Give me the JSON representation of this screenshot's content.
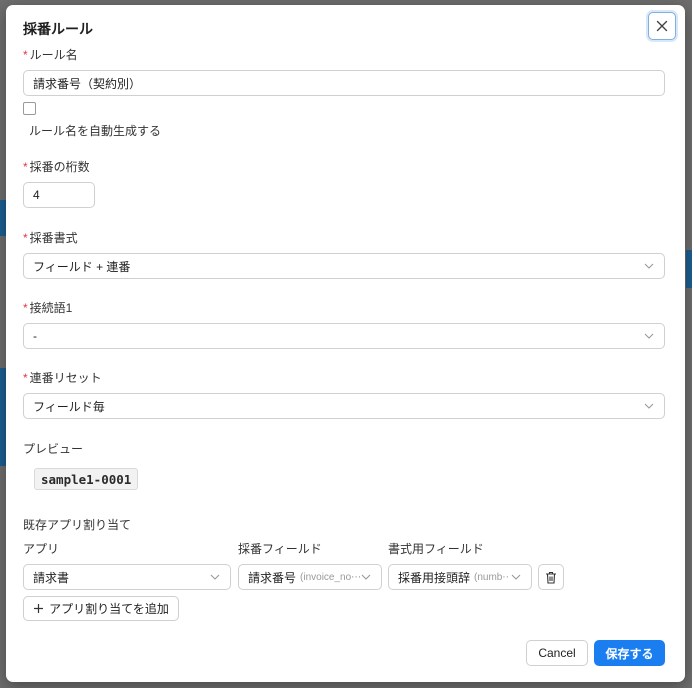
{
  "dialog": {
    "title": "採番ルール",
    "close_icon": "close-icon"
  },
  "form": {
    "required_mark": "*",
    "rule_name": {
      "label": "ルール名",
      "value": "請求番号（契約別）"
    },
    "auto_generate": {
      "label": "ルール名を自動生成する",
      "checked": false
    },
    "digits": {
      "label": "採番の桁数",
      "value": "4"
    },
    "format": {
      "label": "採番書式",
      "value": "フィールド + 連番"
    },
    "connector": {
      "label": "接続語1",
      "value": "-"
    },
    "reset": {
      "label": "連番リセット",
      "value": "フィールド毎"
    },
    "preview": {
      "label": "プレビュー",
      "value": "sample1-0001"
    }
  },
  "assignments": {
    "section_label": "既存アプリ割り当て",
    "columns": {
      "app": "アプリ",
      "numbering_field": "採番フィールド",
      "format_field": "書式用フィールド"
    },
    "rows": [
      {
        "app": "請求書",
        "numbering_field": "請求番号",
        "numbering_field_hint": "(invoice_no⋯",
        "format_field": "採番用接頭辞",
        "format_field_hint": "(numb⋯",
        "delete_icon": "trash-icon"
      }
    ],
    "add_button": "アプリ割り当てを追加"
  },
  "footer": {
    "cancel": "Cancel",
    "save": "保存する"
  },
  "colors": {
    "primary": "#1a7ef1",
    "required": "#e0393e",
    "overlay": "#6e6e6e"
  }
}
